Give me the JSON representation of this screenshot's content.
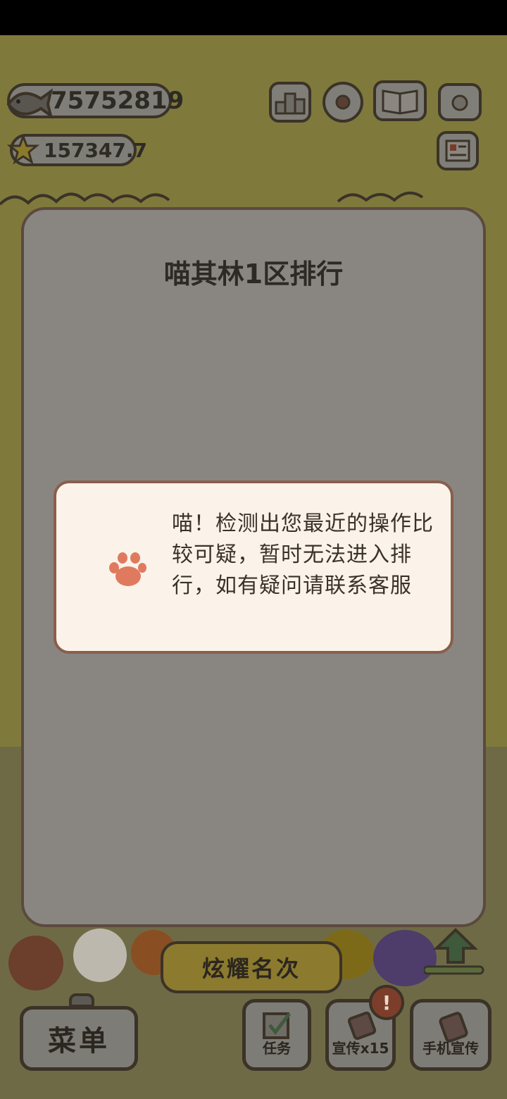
{
  "currency": {
    "fish_value": "75752819",
    "star_value": "157347.7"
  },
  "top_icons": [
    "ranking-icon",
    "settings-gear-icon",
    "catalog-book-icon",
    "camera-icon",
    "newspaper-icon"
  ],
  "modal": {
    "title": "喵其林1区排行",
    "message": "喵！检测出您最近的操作比较可疑，暂时无法进入排行，如有疑问请联系客服"
  },
  "bottom_bar": {
    "flaunt_label": "炫耀名次",
    "menu_label": "菜单",
    "tasks_label": "任务",
    "promote_label": "宣传x15",
    "phone_promote_label": "手机宣传",
    "alert_mark": "!"
  },
  "colors": {
    "modal_bg": "#898682",
    "toast_bg": "#fbf3ea",
    "paw": "#e07a5f",
    "border": "#3b3328"
  }
}
